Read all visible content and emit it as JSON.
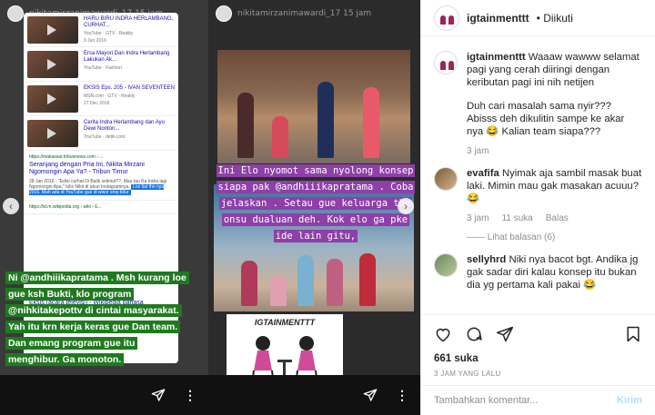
{
  "story1": {
    "username": "nikitamirzanimawardi_17 15 jam",
    "videos": [
      {
        "title": "HARU BIRU INDRA HERLAMBANG, CURHAT...",
        "meta1": "YouTube · GTV - Reality",
        "meta2": "9 Jun 2016"
      },
      {
        "title": "Ersa Mayori Dan Indra Herlambang Lakukan Ak...",
        "meta1": "YouTube · Fashion",
        "meta2": ""
      },
      {
        "title": "EKSIS Eps. 205 - IVAN SEVENTEEN",
        "meta1": "MSN.com · GTV - Reality",
        "meta2": "27 Dec 2016"
      },
      {
        "title": "Cerita Indra Herlambang dan Ayu Dewi Nonton...",
        "meta1": "YouTube · detik.com",
        "meta2": ""
      }
    ],
    "result1": {
      "url": "https://makassar.tribunnews.com › ...",
      "title": "Seranjang dengan Pria Ini, Nikita Mirzani Ngomongin Apa Ya? - Tribun Timur",
      "snippet": "28 Jan 2016 - \"Edisi curhat Di Balik selimut??, Mau tau Ka Indra lagi Ngomongin Apa,\" tulis Nikit di akun Instagramnya."
    },
    "highlight": "Loe liat thn nya 2016. Mah ada di YouTube gue di wwor smp tidur",
    "result2": {
      "url": "https://id.m.wikipedia.org › wiki › E...",
      "title": "Eksis (acara televisi) - Wikipedia bahasa Indonesia, ensiklopedia bebas"
    },
    "caption": "Ni @andhiiikapratama . Msh kurang loe gue ksh Bukti, klo program @nihkitakepottv di cintai masyarakat. Yah itu krn kerja keras gue Dan team. Dan emang program gue itu menghibur. Ga monoton."
  },
  "story2": {
    "username": "nikitamirzanimawardi_17 15 jam",
    "caption": "Ini Elo nyomot sama nyolong konsep siapa pak @andhiiikapratama . Coba jelaskan . Setau gue keluarga the onsu dualuan deh. Kok elo ga pke ide lain gitu,",
    "logo_text": "IGTAINMENTTT"
  },
  "nav": {
    "prev": "‹",
    "next": "›"
  },
  "post": {
    "username": "igtainmenttt",
    "follow_status": "• Diikuti",
    "caption_user": "igtainmenttt",
    "caption_text": "Waaaw wawww selamat pagi yang cerah diiringi dengan keributan pagi ini nih netijen",
    "caption_text2": "Duh cari masalah sama nyir??? Abisss deh dikulitin sampe ke akar nya 😂 Kalian team siapa???",
    "caption_time": "3 jam",
    "comments": [
      {
        "user": "evafifa",
        "text": "Nyimak aja sambil masak buat laki. Mimin mau gak masakan acuuu? 😂",
        "time": "3 jam",
        "likes": "11 suka",
        "reply": "Balas",
        "replies": "Lihat balasan (6)"
      },
      {
        "user": "sellyhrd",
        "text": "Niki nya bacot bgt. Andika jg gak sadar diri kalau konsep itu bukan dia yg pertama kali pakai 😂"
      }
    ],
    "likes": "661 suka",
    "time": "3 JAM YANG LALU",
    "comment_placeholder": "Tambahkan komentar...",
    "post_label": "Kirim"
  },
  "colors": {
    "caption1_bg": "#1f7a1f",
    "caption2_bg": "#8e3fa8",
    "brand": "#a3215a"
  }
}
